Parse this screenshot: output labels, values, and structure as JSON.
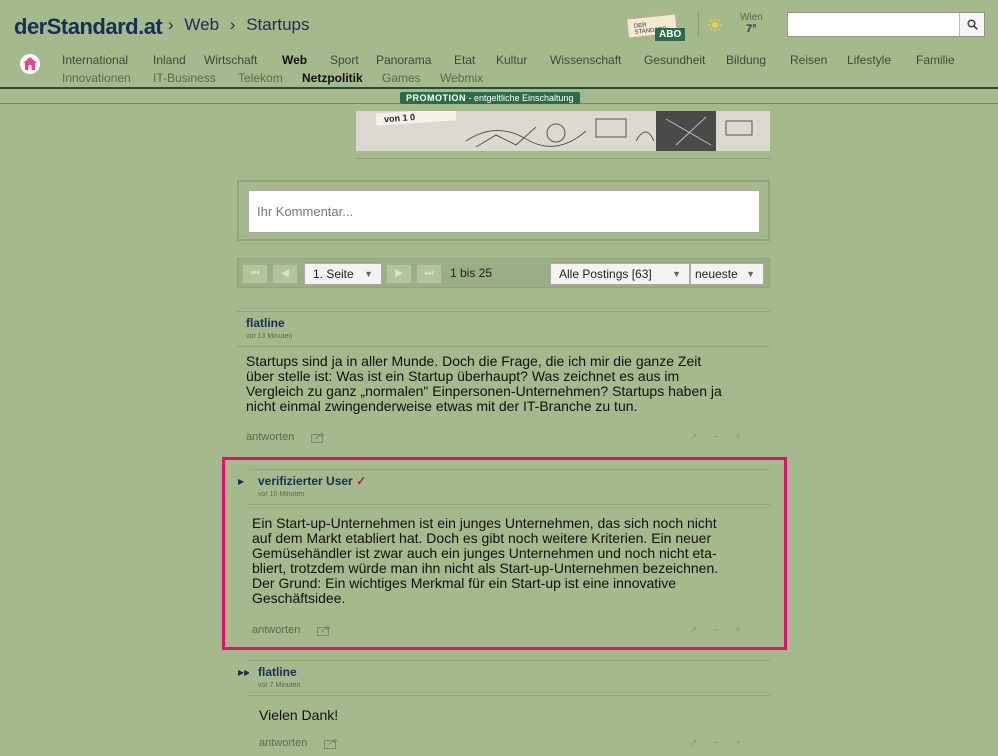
{
  "header": {
    "brand": "derStandard.at",
    "crumb_sep": "›",
    "crumbs": [
      "Web",
      "Startups"
    ],
    "abo_paper": "DER STANDARD",
    "abo_label": "ABO",
    "weather_city": "Wien",
    "weather_temp": "7°",
    "search_placeholder": ""
  },
  "nav": {
    "row1": [
      "International",
      "Inland",
      "Wirtschaft",
      "Web",
      "Sport",
      "Panorama",
      "Etat",
      "Kultur",
      "Wissenschaft",
      "Gesundheit",
      "Bildung",
      "Reisen",
      "Lifestyle",
      "Familie"
    ],
    "row2": [
      "Innovationen",
      "IT-Business",
      "Telekom",
      "Netzpolitik",
      "Games",
      "Webmix"
    ],
    "active_row1": "Web",
    "active_row2": "Netzpolitik"
  },
  "promo": {
    "label_bold": "PROMOTION",
    "label_rest": " - entgeltliche Einschaltung",
    "image_text": "von 1 0"
  },
  "comment": {
    "placeholder": "Ihr Kommentar..."
  },
  "pager": {
    "first": "⏮",
    "prev": "◀",
    "page": "1. Seite",
    "next": "▶",
    "last": "⏭",
    "range": "1 bis 25",
    "filter": "Alle Postings",
    "filter_count": "[63]",
    "sort": "neueste"
  },
  "posts": [
    {
      "user": "flatline",
      "time": "vor 13 Minuten",
      "lines": [
        "Startups sind ja in aller Munde. Doch die Frage, die ich mir die ganze Zeit",
        "über stelle ist: Was ist ein Startup überhaupt? Was zeichnet es aus im",
        "Vergleich zu ganz „normalen\" Einpersonen-Unternehmen? Startups haben ja",
        "nicht einmal zwingenderweise etwas mit der IT-Branche zu tun."
      ],
      "reply": "antworten"
    },
    {
      "user": "verifizierter User",
      "verified": "✓",
      "time": "vor 10 Minuten",
      "lines": [
        "Ein Start-up-Unternehmen ist ein junges Unternehmen, das sich noch nicht",
        "auf dem Markt etabliert hat. Doch es gibt noch weitere Kriterien. Ein neuer",
        "Gemüsehändler ist zwar auch ein junges Unternehmen und noch nicht eta-",
        "bliert, trotzdem würde man ihn nicht als Start-up-Unternehmen bezeichnen.",
        "Der Grund: Ein wichtiges Merkmal für ein Start-up ist eine innovative",
        "Geschäftsidee."
      ],
      "reply": "antworten"
    },
    {
      "user": "flatline",
      "time": "vor 7 Minuten",
      "lines": [
        "Vielen Dank!"
      ],
      "reply": "antworten"
    }
  ],
  "colors": {
    "page_bg": "#a4b98c",
    "brand": "#1a2e5a",
    "highlight": "#e0106e",
    "promo": "#2d6c49"
  }
}
